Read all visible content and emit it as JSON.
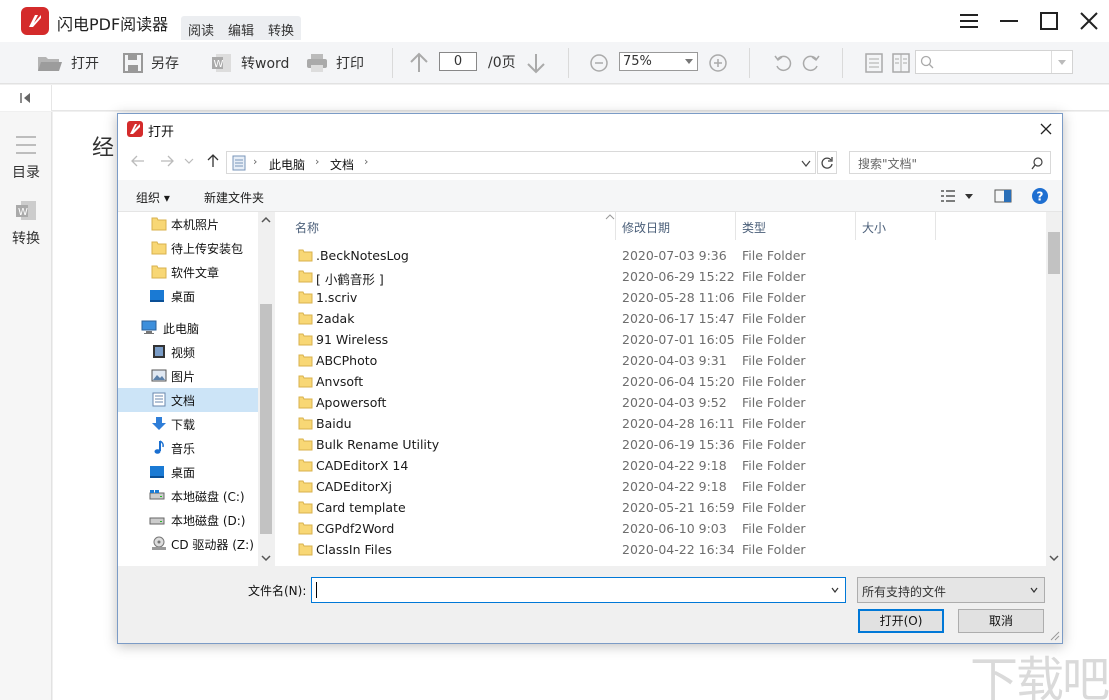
{
  "app": {
    "title": "闪电PDF阅读器",
    "menu_tabs": [
      "阅读",
      "编辑",
      "转换"
    ]
  },
  "toolbar": {
    "open": "打开",
    "save_as": "另存",
    "to_word": "转word",
    "print": "打印",
    "page_current": "0",
    "page_total": "/0页",
    "zoom": "75%"
  },
  "sidebar": {
    "toc": "目录",
    "convert": "转换"
  },
  "document": {
    "text": "经"
  },
  "dialog": {
    "title": "打开",
    "breadcrumb": [
      "此电脑",
      "文档"
    ],
    "search_placeholder": "搜索\"文档\"",
    "organize": "组织 ▾",
    "new_folder": "新建文件夹",
    "nav_items": [
      {
        "label": "本机照片",
        "icon": "folder-icon"
      },
      {
        "label": "待上传安装包",
        "icon": "folder-icon"
      },
      {
        "label": "软件文章",
        "icon": "folder-icon"
      },
      {
        "label": "桌面",
        "icon": "desktop-icon"
      },
      {
        "label": "此电脑",
        "icon": "computer-icon"
      },
      {
        "label": "视频",
        "icon": "video-icon"
      },
      {
        "label": "图片",
        "icon": "picture-icon"
      },
      {
        "label": "文档",
        "icon": "document-icon"
      },
      {
        "label": "下载",
        "icon": "download-icon"
      },
      {
        "label": "音乐",
        "icon": "music-icon"
      },
      {
        "label": "桌面",
        "icon": "desktop-icon"
      },
      {
        "label": "本地磁盘 (C:)",
        "icon": "drive-icon"
      },
      {
        "label": "本地磁盘 (D:)",
        "icon": "drive-icon"
      },
      {
        "label": "CD 驱动器 (Z:)",
        "icon": "cd-drive-icon"
      }
    ],
    "columns": {
      "name": "名称",
      "date": "修改日期",
      "type": "类型",
      "size": "大小"
    },
    "files": [
      {
        "name": ".BeckNotesLog",
        "date": "2020-07-03 9:36",
        "type": "File Folder"
      },
      {
        "name": "[ 小鹤音形 ]",
        "date": "2020-06-29 15:22",
        "type": "File Folder"
      },
      {
        "name": "1.scriv",
        "date": "2020-05-28 11:06",
        "type": "File Folder"
      },
      {
        "name": "2adak",
        "date": "2020-06-17 15:47",
        "type": "File Folder"
      },
      {
        "name": "91 Wireless",
        "date": "2020-07-01 16:05",
        "type": "File Folder"
      },
      {
        "name": "ABCPhoto",
        "date": "2020-04-03 9:31",
        "type": "File Folder"
      },
      {
        "name": "Anvsoft",
        "date": "2020-06-04 15:20",
        "type": "File Folder"
      },
      {
        "name": "Apowersoft",
        "date": "2020-04-03 9:52",
        "type": "File Folder"
      },
      {
        "name": "Baidu",
        "date": "2020-04-28 16:11",
        "type": "File Folder"
      },
      {
        "name": "Bulk Rename Utility",
        "date": "2020-06-19 15:36",
        "type": "File Folder"
      },
      {
        "name": "CADEditorX 14",
        "date": "2020-04-22 9:18",
        "type": "File Folder"
      },
      {
        "name": "CADEditorXj",
        "date": "2020-04-22 9:18",
        "type": "File Folder"
      },
      {
        "name": "Card template",
        "date": "2020-05-21 16:59",
        "type": "File Folder"
      },
      {
        "name": "CGPdf2Word",
        "date": "2020-06-10 9:03",
        "type": "File Folder"
      },
      {
        "name": "ClassIn Files",
        "date": "2020-04-22 16:34",
        "type": "File Folder"
      }
    ],
    "filename_label": "文件名(N):",
    "filename_value": "",
    "filetype": "所有支持的文件",
    "open_button": "打开(O)",
    "cancel_button": "取消"
  },
  "watermark": "下载吧",
  "colors": {
    "brand": "#d42b2b",
    "selection": "#cce4f7",
    "focus": "#0078d7",
    "folder": "#f8d775"
  }
}
